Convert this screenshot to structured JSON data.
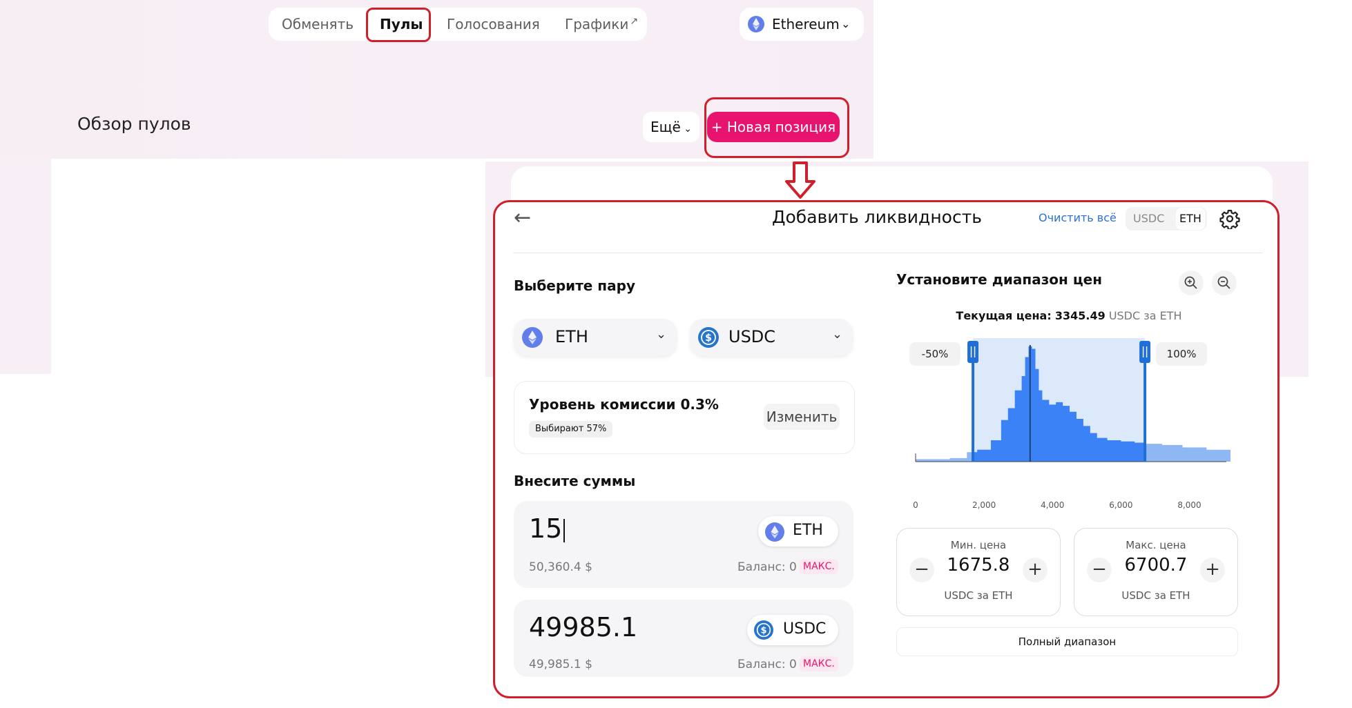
{
  "nav": {
    "items": [
      "Обменять",
      "Пулы",
      "Голосования",
      "Графики"
    ],
    "external_mark": "↗"
  },
  "network": {
    "label": "Ethereum",
    "icon": "ethereum-icon"
  },
  "pools": {
    "title": "Обзор пулов",
    "more_label": "Ещё",
    "new_position_label": "+ Новая позиция"
  },
  "panel": {
    "title": "Добавить ликвидность",
    "clear_all": "Очистить всё",
    "units": [
      "USDC",
      "ETH"
    ],
    "selected_unit": "ETH",
    "pair_title": "Выберите пару",
    "token_a": "ETH",
    "token_b": "USDC",
    "fee": {
      "title": "Уровень комиссии 0.3%",
      "badge": "Выбирают 57%",
      "change_label": "Изменить"
    },
    "amounts_title": "Внесите суммы",
    "amounts": [
      {
        "value": "15",
        "usd": "50,360.4 $",
        "token": "ETH",
        "balance": "Баланс: 0",
        "max": "МАКС."
      },
      {
        "value": "49985.1",
        "usd": "49,985.1 $",
        "token": "USDC",
        "balance": "Баланс: 0",
        "max": "МАКС."
      }
    ],
    "range": {
      "title": "Установите диапазон цен",
      "current_label": "Текущая цена:",
      "current_value": "3345.49",
      "current_unit": "USDC за ETH",
      "min": {
        "label": "Мин. цена",
        "value": "1675.8",
        "unit": "USDC за ETH"
      },
      "max": {
        "label": "Макс. цена",
        "value": "6700.7",
        "unit": "USDC за ETH"
      },
      "full_range": "Полный диапазон"
    }
  },
  "chart_data": {
    "type": "area",
    "x_ticks": [
      "0",
      "2,000",
      "4,000",
      "6,000",
      "8,000"
    ],
    "xlim": [
      0,
      9200
    ],
    "current_price": 3345.49,
    "range_min": 1675.8,
    "range_max": 6700.7,
    "min_pct_label": "-50%",
    "max_pct_label": "100%",
    "series_color": "#3b82f6",
    "liquidity": [
      [
        0,
        2
      ],
      [
        1000,
        3
      ],
      [
        1500,
        8
      ],
      [
        1800,
        10
      ],
      [
        2200,
        18
      ],
      [
        2500,
        35
      ],
      [
        2700,
        45
      ],
      [
        2900,
        60
      ],
      [
        3100,
        72
      ],
      [
        3200,
        88
      ],
      [
        3300,
        97
      ],
      [
        3400,
        95
      ],
      [
        3500,
        78
      ],
      [
        3600,
        60
      ],
      [
        3700,
        52
      ],
      [
        3900,
        48
      ],
      [
        4100,
        50
      ],
      [
        4300,
        47
      ],
      [
        4500,
        42
      ],
      [
        4700,
        36
      ],
      [
        4900,
        30
      ],
      [
        5100,
        24
      ],
      [
        5300,
        20
      ],
      [
        5600,
        18
      ],
      [
        6000,
        17
      ],
      [
        6400,
        16
      ],
      [
        6700,
        15
      ],
      [
        7200,
        14
      ],
      [
        7800,
        12
      ],
      [
        8500,
        10
      ],
      [
        9200,
        8
      ]
    ]
  }
}
